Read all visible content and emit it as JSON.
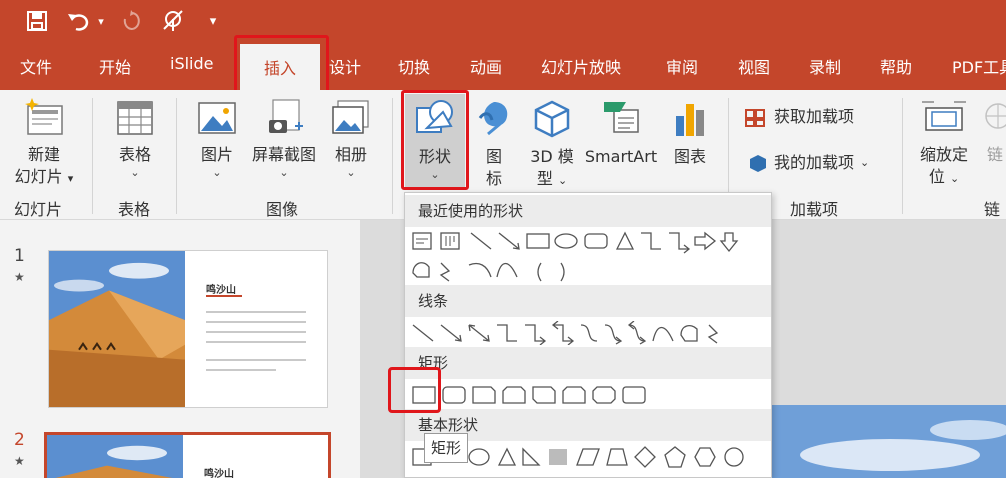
{
  "quick_access": {
    "icons": [
      "save-icon",
      "undo-icon",
      "undo-dropdown-icon",
      "repeat-icon",
      "touch-mode-icon",
      "customize-dropdown-icon"
    ]
  },
  "tabs": [
    {
      "label": "文件"
    },
    {
      "label": "开始"
    },
    {
      "label": "iSlide"
    },
    {
      "label": "插入"
    },
    {
      "label": "设计"
    },
    {
      "label": "切换"
    },
    {
      "label": "动画"
    },
    {
      "label": "幻灯片放映"
    },
    {
      "label": "审阅"
    },
    {
      "label": "视图"
    },
    {
      "label": "录制"
    },
    {
      "label": "帮助"
    },
    {
      "label": "PDF工具"
    }
  ],
  "ribbon": {
    "new_slide": {
      "line1": "新建",
      "line2": "幻灯片"
    },
    "table": "表格",
    "picture": "图片",
    "screenshot": "屏幕截图",
    "album": "相册",
    "shapes": "形状",
    "icons": {
      "line1": "图",
      "line2": "标"
    },
    "model3d": {
      "line1": "3D 模",
      "line2": "型"
    },
    "smartart": "SmartArt",
    "chart": "图表",
    "get_addins": "获取加载项",
    "my_addins": "我的加载项",
    "zoom": {
      "line1": "缩放定",
      "line2": "位"
    },
    "link_partial": "链",
    "groups": {
      "slides": "幻灯片",
      "tables": "表格",
      "images": "图像",
      "addins": "加载项",
      "links": "链"
    }
  },
  "gallery": {
    "sections": [
      "最近使用的形状",
      "线条",
      "矩形",
      "基本形状"
    ],
    "tooltip": "矩形"
  },
  "slides": [
    {
      "number": "1",
      "title": "鸣沙山",
      "star": "★"
    },
    {
      "number": "2",
      "title": "鸣沙山",
      "star": "★"
    }
  ],
  "colors": {
    "accent": "#c4462b",
    "highlight": "#e0161b"
  }
}
